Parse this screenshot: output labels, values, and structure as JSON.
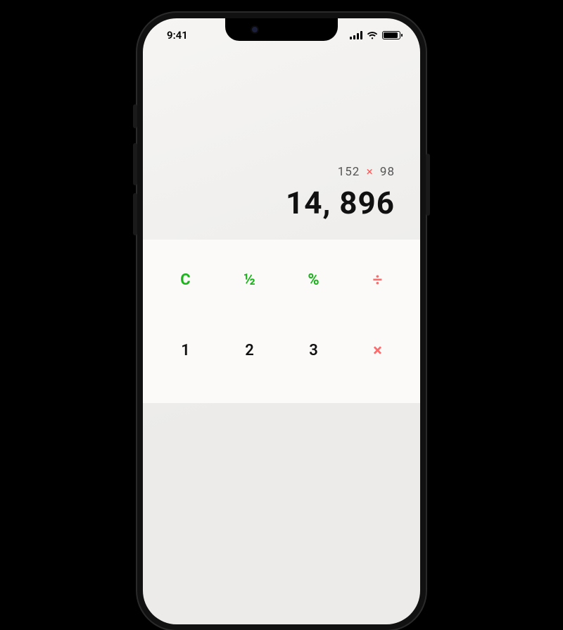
{
  "status": {
    "time": "9:41"
  },
  "display": {
    "expr_left": "152",
    "expr_op": "×",
    "expr_right": "98",
    "result": "14, 896"
  },
  "keys": {
    "row1": {
      "clear": "C",
      "half": "½",
      "percent": "%",
      "divide": "÷"
    },
    "row2": {
      "d1": "1",
      "d2": "2",
      "d3": "3",
      "multiply": "×"
    }
  }
}
